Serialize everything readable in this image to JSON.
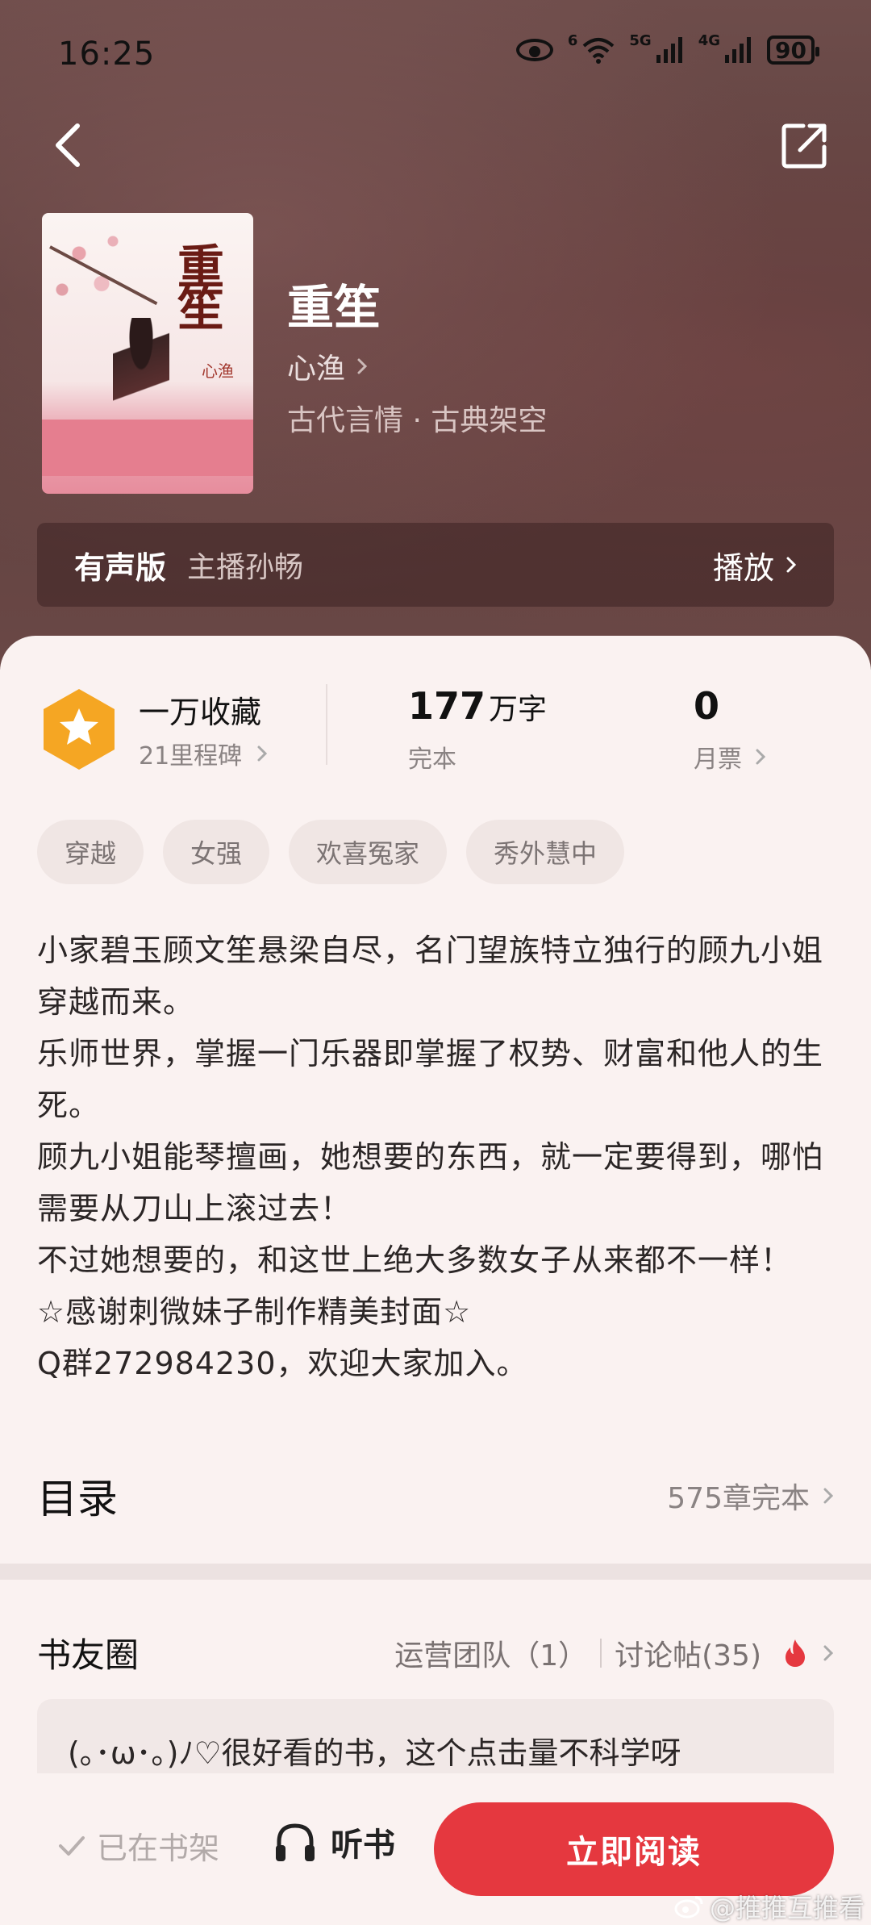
{
  "status": {
    "time": "16:25",
    "network_wifi": "6",
    "network_a": "5G",
    "network_b": "4G",
    "battery": "90"
  },
  "book": {
    "title": "重笙",
    "author": "心渔",
    "category": "古代言情 · 古典架空",
    "cover_title": "重笙",
    "cover_author": "心渔"
  },
  "audio": {
    "badge": "有声版",
    "host": "主播孙畅",
    "play": "播放"
  },
  "stats": {
    "collection": "一万收藏",
    "milestone": "21里程碑",
    "words_value": "177",
    "words_unit": "万字",
    "words_status": "完本",
    "monthly_tickets": "0",
    "monthly_label": "月票"
  },
  "tags": [
    "穿越",
    "女强",
    "欢喜冤家",
    "秀外慧中"
  ],
  "intro": [
    "小家碧玉顾文笙悬梁自尽，名门望族特立独行的顾九小姐穿越而来。",
    "乐师世界，掌握一门乐器即掌握了权势、财富和他人的生死。",
    "顾九小姐能琴擅画，她想要的东西，就一定要得到，哪怕需要从刀山上滚过去！",
    "不过她想要的，和这世上绝大多数女子从来都不一样！",
    "☆感谢刺微妹子制作精美封面☆",
    "Q群272984230，欢迎大家加入。"
  ],
  "toc": {
    "title": "目录",
    "status": "575章完本"
  },
  "circle": {
    "title": "书友圈",
    "ops_team": "运营团队（1）",
    "discussions": "讨论帖(35)",
    "comment": "(｡･ω･｡)ﾉ♡很好看的书，这个点击量不科学呀"
  },
  "bottom": {
    "shelf": "已在书架",
    "listen": "听书",
    "read": "立即阅读"
  },
  "watermark": "@推推互推看",
  "colors": {
    "accent": "#e5383f",
    "rank_badge": "#f5a623"
  }
}
